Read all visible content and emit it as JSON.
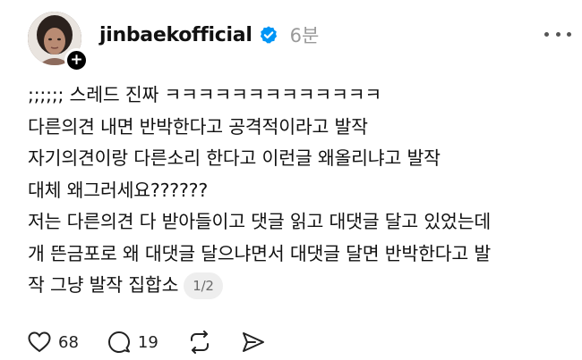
{
  "post": {
    "author": {
      "username": "jinbaekofficial",
      "verified": true
    },
    "time": "6분",
    "lines": [
      ";;;;;; 스레드 진짜 ㅋㅋㅋㅋㅋㅋㅋㅋㅋㅋㅋㅋㅋ",
      "다른의견 내면 반박한다고 공격적이라고 발작",
      "자기의견이랑 다른소리 한다고 이런글 왜올리냐고 발작",
      "대체 왜그러세요??????",
      "저는 다른의견 다 받아들이고 댓글 읽고 대댓글 달고 있었는데",
      "개 뜬금포로 왜 대댓글 달으냐면서 대댓글 달면 반박한다고 발",
      "작 그냥 발작 집합소"
    ],
    "pager": "1/2"
  },
  "actions": {
    "likes": "68",
    "comments": "19"
  },
  "icons": [
    "avatar",
    "plus-icon",
    "verified-icon",
    "more-icon",
    "heart-icon",
    "comment-icon",
    "repost-icon",
    "share-icon"
  ]
}
